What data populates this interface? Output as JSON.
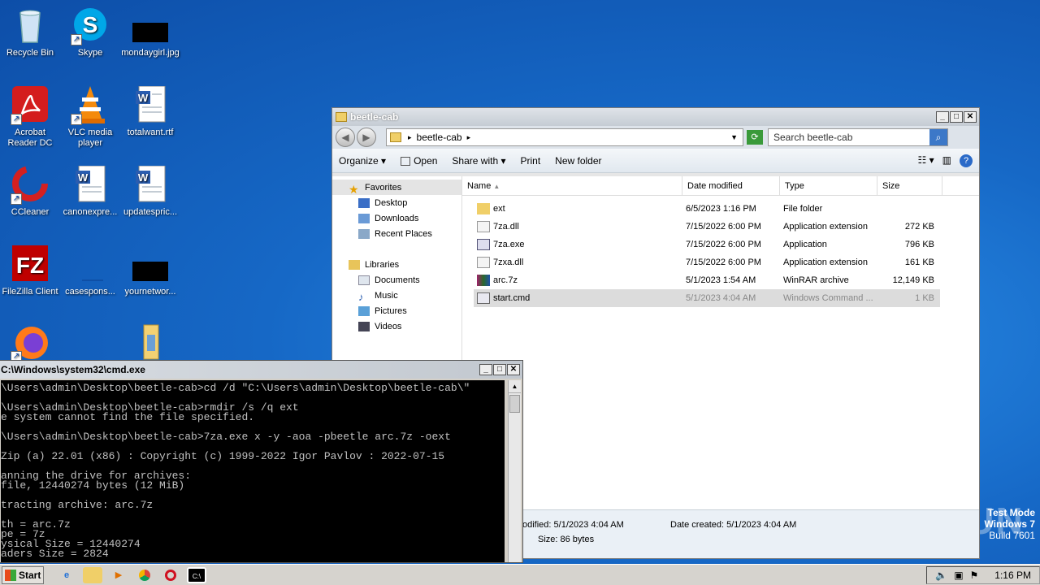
{
  "desktop": {
    "icons": [
      {
        "label": "Recycle Bin",
        "icon": "recycle-bin-icon"
      },
      {
        "label": "Skype",
        "icon": "skype-icon"
      },
      {
        "label": "mondaygirl.jpg",
        "icon": "image-file-icon"
      },
      {
        "label": "Acrobat Reader DC",
        "icon": "acrobat-icon"
      },
      {
        "label": "VLC media player",
        "icon": "vlc-icon"
      },
      {
        "label": "totalwant.rtf",
        "icon": "word-doc-icon"
      },
      {
        "label": "CCleaner",
        "icon": "ccleaner-icon"
      },
      {
        "label": "canonexpre...",
        "icon": "word-doc-icon"
      },
      {
        "label": "updatespric...",
        "icon": "word-doc-icon"
      },
      {
        "label": "FileZilla Client",
        "icon": "filezilla-icon"
      },
      {
        "label": "casespons...",
        "icon": "blank-file-icon"
      },
      {
        "label": "yournetwor...",
        "icon": "image-file-icon"
      }
    ]
  },
  "explorer": {
    "title": "beetle-cab",
    "address": "beetle-cab",
    "search_placeholder": "Search beetle-cab",
    "toolbar": {
      "organize": "Organize",
      "open": "Open",
      "share": "Share with",
      "print": "Print",
      "new_folder": "New folder"
    },
    "nav": {
      "favorites": "Favorites",
      "desktop": "Desktop",
      "downloads": "Downloads",
      "recent": "Recent Places",
      "libraries": "Libraries",
      "documents": "Documents",
      "music": "Music",
      "pictures": "Pictures",
      "videos": "Videos"
    },
    "columns": {
      "name": "Name",
      "date": "Date modified",
      "type": "Type",
      "size": "Size"
    },
    "files": [
      {
        "name": "ext",
        "date": "6/5/2023 1:16 PM",
        "type": "File folder",
        "size": ""
      },
      {
        "name": "7za.dll",
        "date": "7/15/2022 6:00 PM",
        "type": "Application extension",
        "size": "272 KB"
      },
      {
        "name": "7za.exe",
        "date": "7/15/2022 6:00 PM",
        "type": "Application",
        "size": "796 KB"
      },
      {
        "name": "7zxa.dll",
        "date": "7/15/2022 6:00 PM",
        "type": "Application extension",
        "size": "161 KB"
      },
      {
        "name": "arc.7z",
        "date": "5/1/2023 1:54 AM",
        "type": "WinRAR archive",
        "size": "12,149 KB"
      },
      {
        "name": "start.cmd",
        "date": "5/1/2023 4:04 AM",
        "type": "Windows Command ...",
        "size": "1 KB"
      }
    ],
    "details": {
      "modified": "odified: 5/1/2023 4:04 AM",
      "created": "Date created: 5/1/2023 4:04 AM",
      "size": "Size: 86 bytes"
    }
  },
  "cmd": {
    "title": "C:\\Windows\\system32\\cmd.exe",
    "lines": [
      "\\Users\\admin\\Desktop\\beetle-cab>cd /d \"C:\\Users\\admin\\Desktop\\beetle-cab\\\"",
      "",
      "\\Users\\admin\\Desktop\\beetle-cab>rmdir /s /q ext",
      "e system cannot find the file specified.",
      "",
      "\\Users\\admin\\Desktop\\beetle-cab>7za.exe x -y -aoa -pbeetle arc.7z -oext",
      "",
      "Zip (a) 22.01 (x86) : Copyright (c) 1999-2022 Igor Pavlov : 2022-07-15",
      "",
      "anning the drive for archives:",
      "file, 12440274 bytes (12 MiB)",
      "",
      "tracting archive: arc.7z",
      "",
      "th = arc.7z",
      "pe = 7z",
      "ysical Size = 12440274",
      "aders Size = 2824"
    ]
  },
  "taskbar": {
    "start": "Start",
    "clock": "1:16 PM"
  },
  "watermark": {
    "line1": "Test Mode",
    "line2": "Windows 7",
    "line3": "Build 7601",
    "brand": "ANY RUN"
  }
}
